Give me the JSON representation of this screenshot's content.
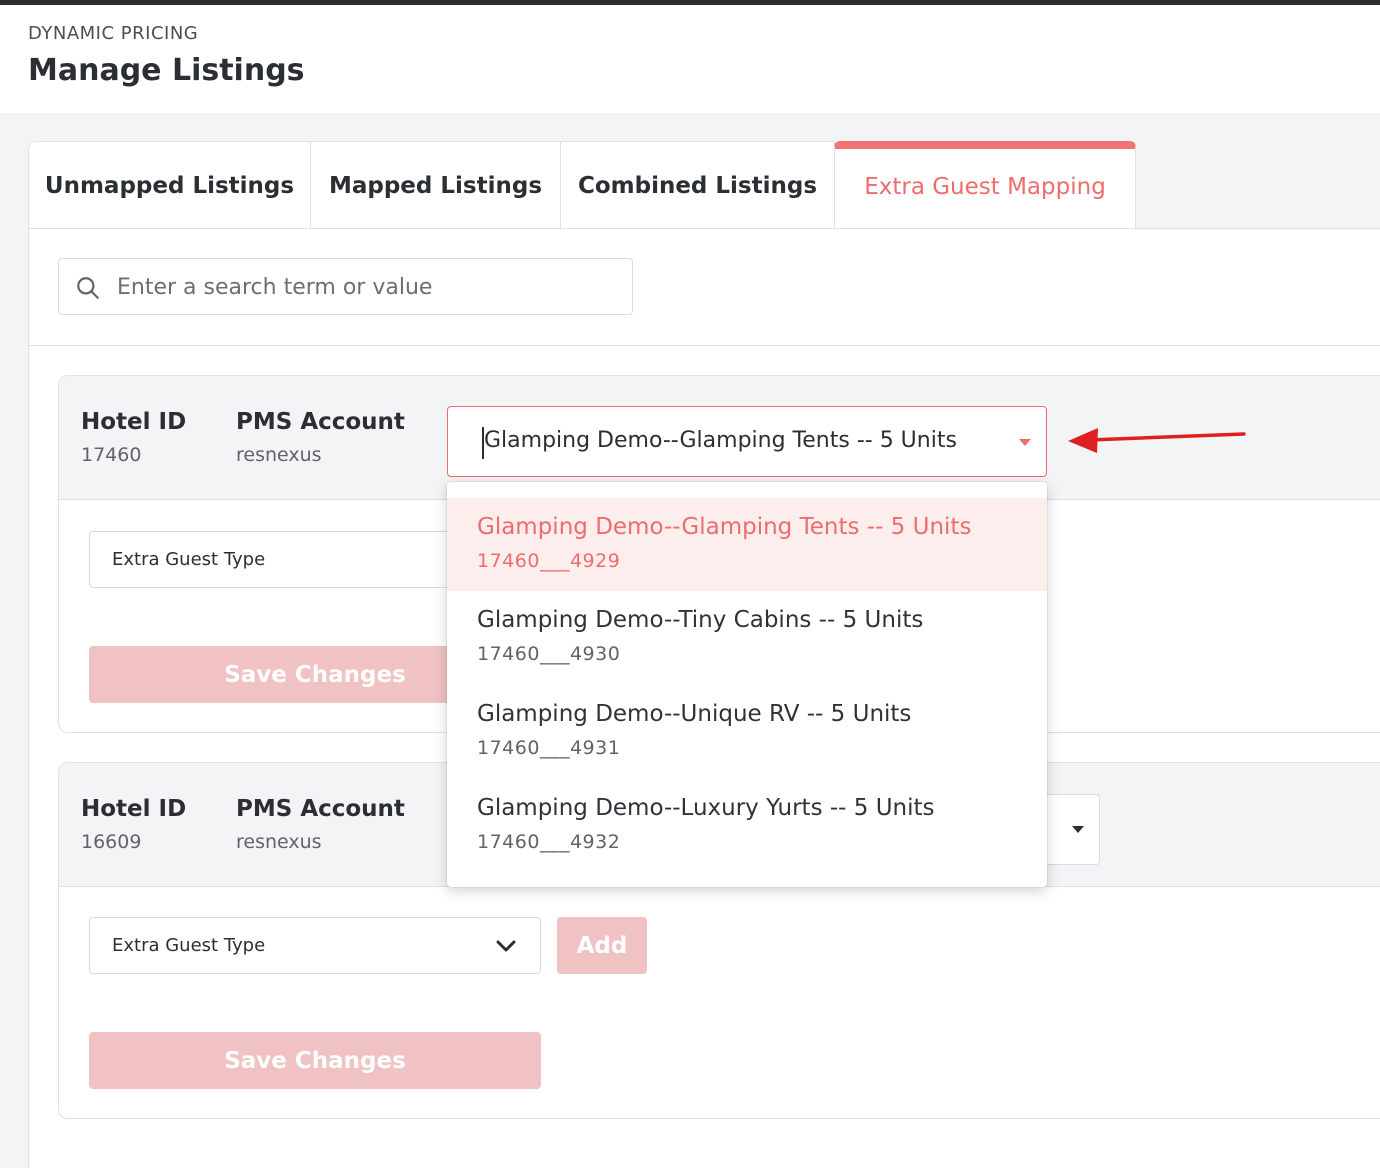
{
  "header": {
    "eyebrow": "DYNAMIC PRICING",
    "title": "Manage Listings"
  },
  "tabs": [
    {
      "label": "Unmapped Listings",
      "active": false
    },
    {
      "label": "Mapped Listings",
      "active": false
    },
    {
      "label": "Combined Listings",
      "active": false
    },
    {
      "label": "Extra Guest Mapping",
      "active": true
    }
  ],
  "search": {
    "placeholder": "Enter a search term or value",
    "value": ""
  },
  "colors": {
    "accent": "#f06b6b",
    "disabled_button": "#f0c2c4",
    "annotation_arrow": "#e02020"
  },
  "cards": [
    {
      "hotel_id_label": "Hotel ID",
      "hotel_id": "17460",
      "pms_label": "PMS Account",
      "pms_account": "resnexus",
      "listing_selected": "Glamping Demo--Glamping Tents -- 5 Units",
      "listing_open": true,
      "extra_guest_type": "Extra Guest Type",
      "save_label": "Save Changes"
    },
    {
      "hotel_id_label": "Hotel ID",
      "hotel_id": "16609",
      "pms_label": "PMS Account",
      "pms_account": "resnexus",
      "listing_open": false,
      "extra_guest_type": "Extra Guest Type",
      "add_label": "Add",
      "save_label": "Save Changes"
    }
  ],
  "dropdown": {
    "options": [
      {
        "title": "Glamping Demo--Glamping Tents -- 5 Units",
        "id": "17460___4929",
        "selected": true
      },
      {
        "title": "Glamping Demo--Tiny Cabins -- 5 Units",
        "id": "17460___4930",
        "selected": false
      },
      {
        "title": "Glamping Demo--Unique RV -- 5 Units",
        "id": "17460___4931",
        "selected": false
      },
      {
        "title": "Glamping Demo--Luxury Yurts -- 5 Units",
        "id": "17460___4932",
        "selected": false
      }
    ]
  }
}
